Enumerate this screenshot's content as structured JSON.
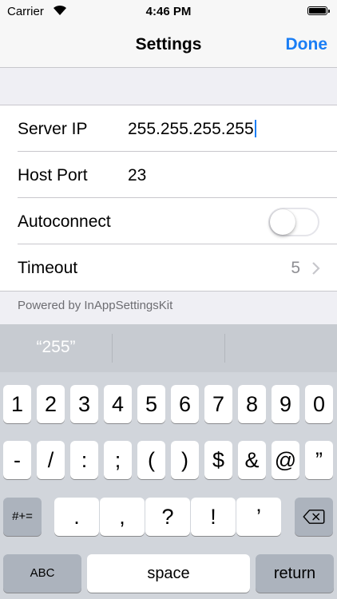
{
  "status_bar": {
    "carrier": "Carrier",
    "time": "4:46 PM"
  },
  "nav": {
    "title": "Settings",
    "done_label": "Done"
  },
  "settings": {
    "rows": [
      {
        "label": "Server IP",
        "value": "255.255.255.255"
      },
      {
        "label": "Host Port",
        "value": "23"
      },
      {
        "label": "Autoconnect",
        "toggle_on": false
      },
      {
        "label": "Timeout",
        "value": "5"
      }
    ],
    "footer": "Powered by InAppSettingsKit"
  },
  "keyboard": {
    "suggestions": [
      "“255”",
      "",
      ""
    ],
    "row1": [
      "1",
      "2",
      "3",
      "4",
      "5",
      "6",
      "7",
      "8",
      "9",
      "0"
    ],
    "row2": [
      "-",
      "/",
      ":",
      ";",
      "(",
      ")",
      "$",
      "&",
      "@",
      "”"
    ],
    "row3": [
      ".",
      ",",
      "?",
      "!",
      "’"
    ],
    "symbols_label": "#+=",
    "abc_label": "ABC",
    "space_label": "space",
    "return_label": "return"
  },
  "colors": {
    "accent": "#1a7ef5",
    "keyboard_bg": "#d1d5db",
    "key_dark": "#acb3bd"
  },
  "icons": {
    "wifi": "wifi-icon",
    "battery": "battery-icon",
    "chevron": "chevron-right-icon",
    "delete": "backspace-icon"
  }
}
